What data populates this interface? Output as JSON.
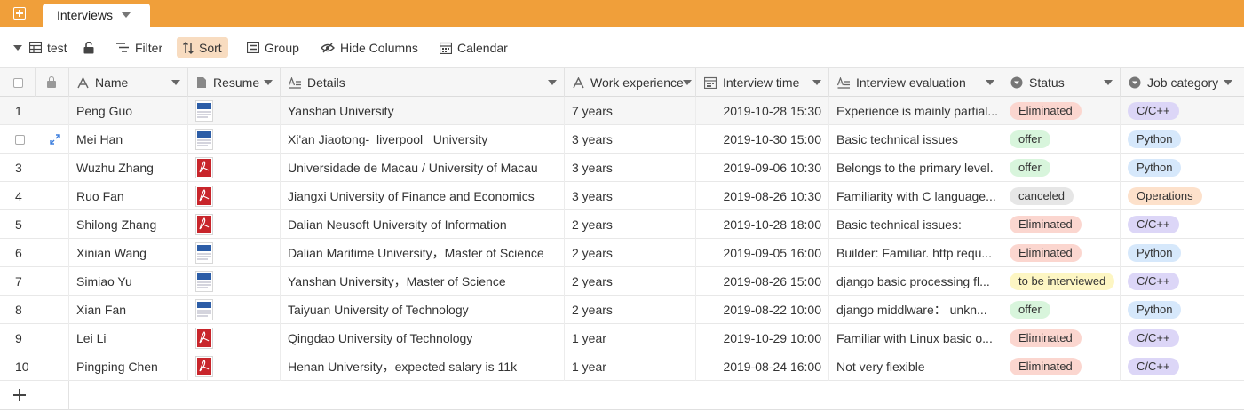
{
  "tabbar": {
    "active_tab": "Interviews"
  },
  "toolbar": {
    "view_name": "test",
    "filter": "Filter",
    "sort": "Sort",
    "group": "Group",
    "hide_columns": "Hide Columns",
    "calendar": "Calendar"
  },
  "columns": [
    {
      "label": "Name",
      "icon": "text-icon"
    },
    {
      "label": "Resume",
      "icon": "file-icon"
    },
    {
      "label": "Details",
      "icon": "long-text-icon"
    },
    {
      "label": "Work experience",
      "icon": "text-icon"
    },
    {
      "label": "Interview time",
      "icon": "calendar-icon"
    },
    {
      "label": "Interview evaluation",
      "icon": "long-text-icon"
    },
    {
      "label": "Status",
      "icon": "single-select-icon"
    },
    {
      "label": "Job category",
      "icon": "single-select-icon"
    }
  ],
  "rows": [
    {
      "num": "1",
      "name": "Peng Guo",
      "resume": "doc",
      "details": "Yanshan University",
      "experience": "7 years",
      "time": "2019-10-28 15:30",
      "evaluation": "Experience is mainly partial...",
      "status": "Eliminated",
      "category": "C/C++"
    },
    {
      "num": "2",
      "name": "Mei Han",
      "resume": "doc",
      "details": "Xi'an Jiaotong-_liverpool_ University",
      "experience": "3 years",
      "time": "2019-10-30 15:00",
      "evaluation": "Basic technical issues",
      "status": "offer",
      "category": "Python"
    },
    {
      "num": "3",
      "name": "Wuzhu Zhang",
      "resume": "pdf",
      "details": "Universidade de Macau / University of Macau",
      "experience": "3 years",
      "time": "2019-09-06 10:30",
      "evaluation": "Belongs to the primary level.",
      "status": "offer",
      "category": "Python"
    },
    {
      "num": "4",
      "name": "Ruo Fan",
      "resume": "pdf",
      "details": "Jiangxi University of Finance and Economics",
      "experience": "3 years",
      "time": "2019-08-26 10:30",
      "evaluation": "Familiarity with C language...",
      "status": "canceled",
      "category": "Operations"
    },
    {
      "num": "5",
      "name": "Shilong Zhang",
      "resume": "pdf",
      "details": "Dalian Neusoft University of Information",
      "experience": "2 years",
      "time": "2019-10-28 18:00",
      "evaluation": "Basic technical issues:",
      "status": "Eliminated",
      "category": "C/C++"
    },
    {
      "num": "6",
      "name": "Xinian Wang",
      "resume": "doc",
      "details": "Dalian Maritime University，Master of Science",
      "experience": "2 years",
      "time": "2019-09-05 16:00",
      "evaluation": "Builder: Familiar. http requ...",
      "status": "Eliminated",
      "category": "Python"
    },
    {
      "num": "7",
      "name": "Simiao Yu",
      "resume": "doc",
      "details": "Yanshan University，Master of Science",
      "experience": "2 years",
      "time": "2019-08-26 15:00",
      "evaluation": "django basic processing fl...",
      "status": "to be interviewed",
      "category": "C/C++"
    },
    {
      "num": "8",
      "name": "Xian Fan",
      "resume": "doc",
      "details": "Taiyuan University of Technology",
      "experience": "2 years",
      "time": "2019-08-22 10:00",
      "evaluation": "django middlware： unkn...",
      "status": "offer",
      "category": "Python"
    },
    {
      "num": "9",
      "name": "Lei Li",
      "resume": "pdf",
      "details": "Qingdao University of Technology",
      "experience": "1 year",
      "time": "2019-10-29 10:00",
      "evaluation": "Familiar with Linux basic o...",
      "status": "Eliminated",
      "category": "C/C++"
    },
    {
      "num": "10",
      "name": "Pingping Chen",
      "resume": "pdf",
      "details": "Henan University，expected salary is 11k",
      "experience": "1 year",
      "time": "2019-08-24 16:00",
      "evaluation": "Not very flexible",
      "status": "Eliminated",
      "category": "C/C++"
    }
  ],
  "status_colors": {
    "Eliminated": "#fbd6cf",
    "offer": "#d8f5dc",
    "canceled": "#e6e6e6",
    "to be interviewed": "#fdf6c3"
  },
  "category_colors": {
    "C/C++": "#dcd6f7",
    "Python": "#d6e8fb",
    "Operations": "#fde1cb"
  },
  "accent_color": "#f09f3a"
}
